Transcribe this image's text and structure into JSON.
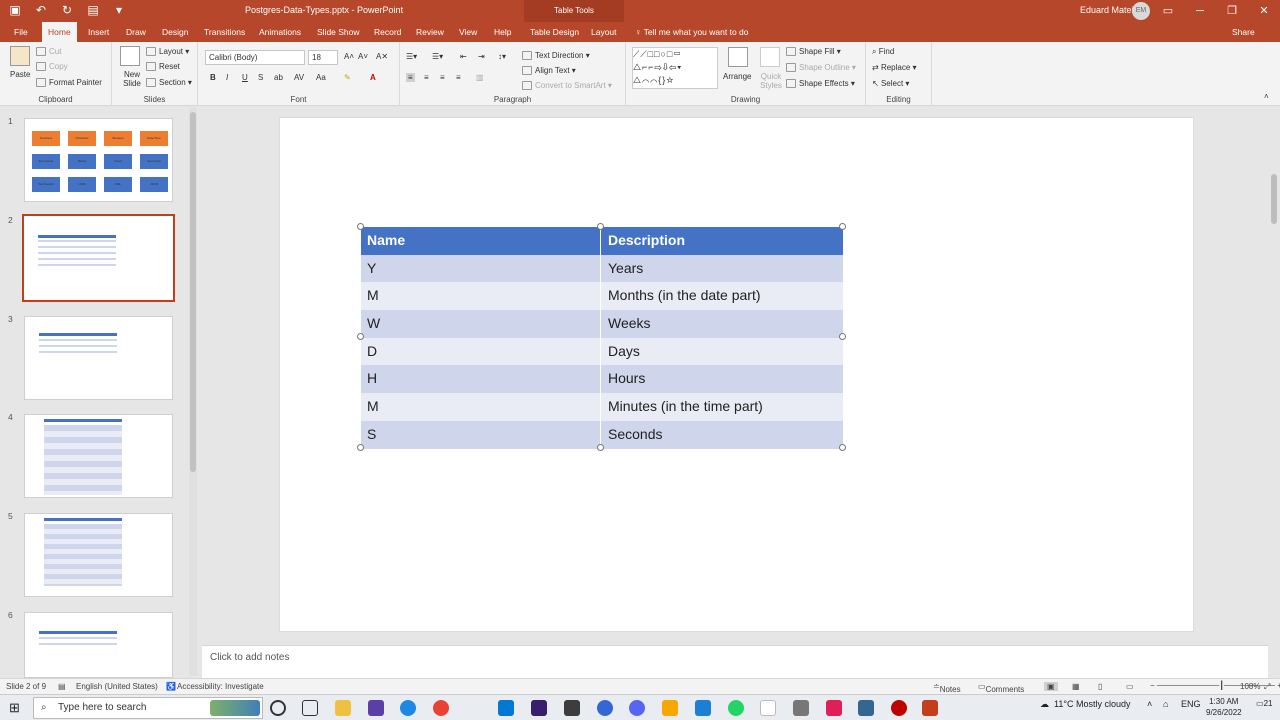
{
  "titlebar": {
    "document_title": "Postgres-Data-Types.pptx - PowerPoint",
    "context_tab_group": "Table Tools",
    "user_name": "Eduard Matei",
    "user_initials": "EM"
  },
  "tabs": [
    "File",
    "Home",
    "Insert",
    "Draw",
    "Design",
    "Transitions",
    "Animations",
    "Slide Show",
    "Record",
    "Review",
    "View",
    "Help",
    "Table Design",
    "Layout"
  ],
  "active_tab": "Home",
  "tell_me": "Tell me what you want to do",
  "share": "Share",
  "ribbon": {
    "clipboard": {
      "paste": "Paste",
      "cut": "Cut",
      "copy": "Copy",
      "format_painter": "Format Painter",
      "label": "Clipboard"
    },
    "slides": {
      "new_slide": "New Slide",
      "layout": "Layout",
      "reset": "Reset",
      "section": "Section",
      "label": "Slides"
    },
    "font": {
      "font_name": "Calibri (Body)",
      "font_size": "18",
      "label": "Font"
    },
    "paragraph": {
      "text_direction": "Text Direction",
      "align_text": "Align Text",
      "convert_smartart": "Convert to SmartArt",
      "label": "Paragraph"
    },
    "drawing": {
      "arrange": "Arrange",
      "quick_styles": "Quick Styles",
      "shape_fill": "Shape Fill",
      "shape_outline": "Shape Outline",
      "shape_effects": "Shape Effects",
      "label": "Drawing"
    },
    "editing": {
      "find": "Find",
      "replace": "Replace",
      "select": "Select",
      "label": "Editing"
    }
  },
  "slides_panel": {
    "numbers": [
      "1",
      "2",
      "3",
      "4",
      "5",
      "6"
    ]
  },
  "slide1_boxes": [
    "Numbers",
    "Character",
    "Boolean",
    "Date/Time",
    "Enumerate",
    "Binary",
    "Fixed",
    "Geometric",
    "Text Search",
    "UUID",
    "XML",
    "JSON"
  ],
  "table": {
    "headers": [
      "Name",
      "Description"
    ],
    "rows": [
      [
        "Y",
        "Years"
      ],
      [
        "M",
        "Months (in the date part)"
      ],
      [
        "W",
        "Weeks"
      ],
      [
        "D",
        "Days"
      ],
      [
        "H",
        "Hours"
      ],
      [
        "M",
        "Minutes (in the time part)"
      ],
      [
        "S",
        "Seconds"
      ]
    ]
  },
  "notes_placeholder": "Click to add notes",
  "status": {
    "slide_count": "Slide 2 of 9",
    "language": "English (United States)",
    "accessibility": "Accessibility: Investigate",
    "notes": "Notes",
    "comments": "Comments",
    "zoom": "108%"
  },
  "taskbar": {
    "search_placeholder": "Type here to search",
    "weather": "11°C  Mostly cloudy",
    "lang": "ENG",
    "time": "1:30 AM",
    "date": "9/26/2022",
    "notification_count": "21"
  },
  "colors": {
    "accent": "#b7472a",
    "table_header": "#4472c4",
    "table_band": "#cfd5ea",
    "table_band_light": "#e9ebf5"
  }
}
